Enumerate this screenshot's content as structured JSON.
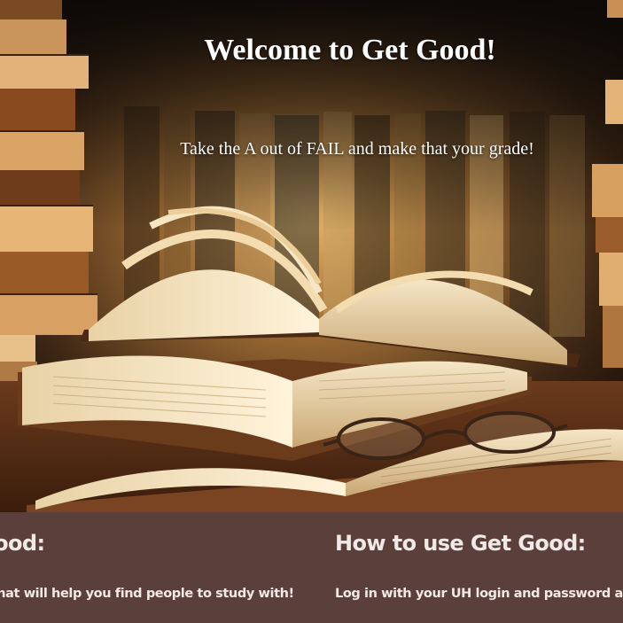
{
  "hero": {
    "title": "Welcome to Get Good!",
    "tagline": "Take the A out of FAIL and make that your grade!",
    "image_icon": "library-books-photo"
  },
  "info": {
    "left": {
      "heading": "What is Get Good:",
      "body": "Get Good is a website that will help you find people to study with!"
    },
    "right": {
      "heading": "How to use Get Good:",
      "body": "Log in with your UH login and password and"
    }
  },
  "colors": {
    "info_background": "#5b3f3a",
    "info_text": "#f1e9e6",
    "hero_text": "#ffffff"
  }
}
